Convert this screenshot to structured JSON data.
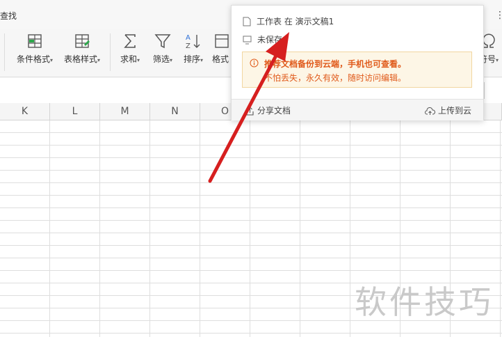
{
  "toolbar": {
    "search_label": "查找",
    "tools": [
      {
        "label": "条件格式",
        "icon": "conditional-format-icon"
      },
      {
        "label": "表格样式",
        "icon": "table-style-icon"
      },
      {
        "label": "求和",
        "icon": "sum-icon"
      },
      {
        "label": "筛选",
        "icon": "filter-icon"
      },
      {
        "label": "排序",
        "icon": "sort-icon"
      },
      {
        "label": "格式",
        "icon": "format-icon"
      },
      {
        "label": "符号",
        "icon": "symbol-icon"
      }
    ]
  },
  "sheet": {
    "columns": [
      "K",
      "L",
      "M",
      "N",
      "O"
    ]
  },
  "popup": {
    "doc_line": "工作表 在 演示文稿1",
    "save_status": "未保存",
    "notice_line1": "推荐文档备份到云端，手机也可查看。",
    "notice_line2": "不怕丢失，永久有效，随时访问编辑。",
    "share_label": "分享文档",
    "upload_label": "上传到云"
  },
  "watermark": "软件技巧",
  "colors": {
    "arrow": "#d61f1f",
    "notice_text": "#e05a1b",
    "notice_bg": "#fdf6e6"
  }
}
